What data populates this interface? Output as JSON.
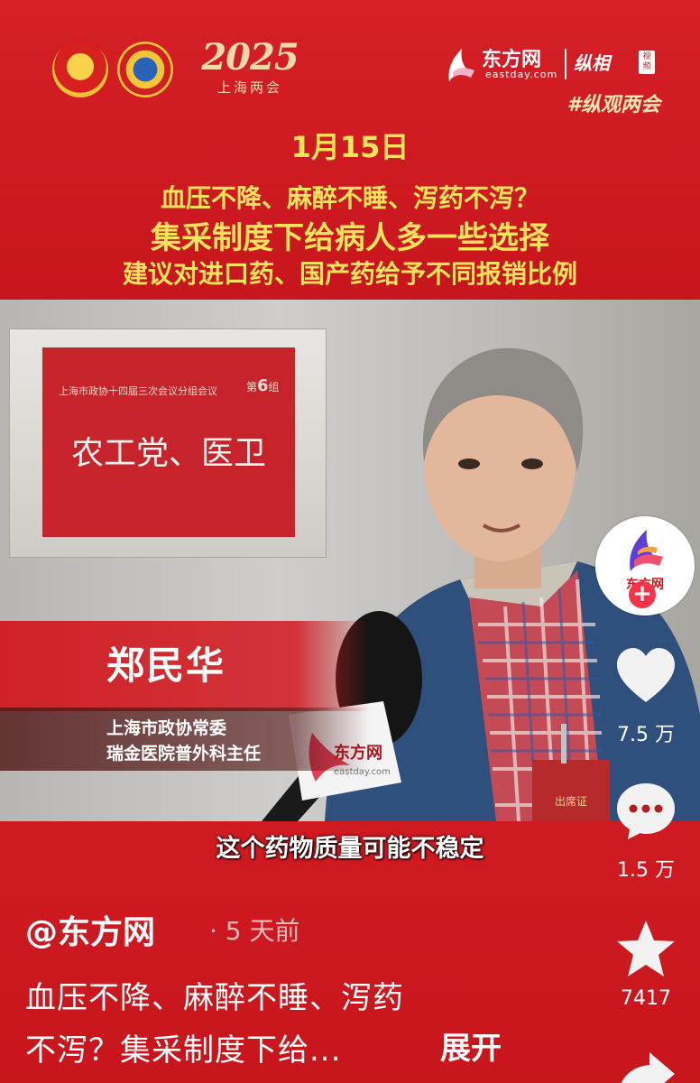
{
  "header": {
    "year": "2025",
    "event": "上海两会",
    "brand_name": "东方网",
    "brand_domain": "eastday.com",
    "brand_sub": "纵相",
    "brand_video": "视频",
    "hashtag": "#纵观两会",
    "date": "1月15日",
    "headline1": "血压不降、麻醉不睡、泻药不泻？",
    "headline2": "集采制度下给病人多一些选择",
    "headline3": "建议对进口药、国产药给予不同报销比例"
  },
  "video": {
    "plaque_small": "上海市政协十四届三次会议分组会议",
    "plaque_group_prefix": "第",
    "plaque_group_num": "6",
    "plaque_group_suffix": "组",
    "plaque_big": "农工党、医卫",
    "mic_brand": "东方网",
    "mic_domain": "eastday.com",
    "badge_text": "出席证",
    "name": "郑民华",
    "role1": "上海市政协常委",
    "role2": "瑞金医院普外科主任",
    "subtitle": "这个药物质量可能不稳定"
  },
  "caption": {
    "author": "@东方网",
    "time": "· 5 天前",
    "desc_line1": "血压不降、麻醉不睡、泻药",
    "desc_line2": "不泻？集采制度下给...",
    "expand": "展开"
  },
  "rail": {
    "avatar_label": "东方网",
    "follow_symbol": "+",
    "likes": "7.5 万",
    "comments": "1.5 万",
    "favorites": "7417"
  },
  "colors": {
    "background": "#c8161d",
    "headline_yellow": "#f8e45a",
    "follow_pink": "#f5344a"
  }
}
